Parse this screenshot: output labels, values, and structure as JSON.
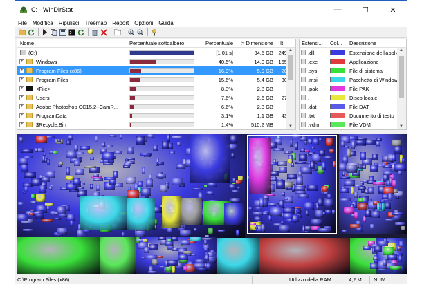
{
  "window": {
    "title": "C: - WinDirStat",
    "controls": {
      "minimize": "—",
      "maximize": "☐",
      "close": "✕"
    }
  },
  "menu": [
    "File",
    "Modifica",
    "Ripulisci",
    "Treemap",
    "Report",
    "Opzioni",
    "Guida"
  ],
  "toolbar_icons": [
    "open-icon",
    "refresh-icon",
    "play-icon",
    "copy-icon",
    "explorer-icon",
    "cmd-icon",
    "refresh-all-icon",
    "recycle-icon",
    "delete-icon",
    "folder-icon",
    "zoom-in-icon",
    "zoom-out-icon",
    "help-icon"
  ],
  "tree": {
    "columns": {
      "name": "Nome",
      "subtree_percent": "Percentuale sottoalbero",
      "percent": "Percentuale",
      "size": "> Dimensione",
      "items": "It"
    },
    "rows": [
      {
        "name": "(C:)",
        "subtree": 1.0,
        "percent": "[1:01 s]",
        "size": "34,5 GB",
        "items": "249",
        "expand": "",
        "icon": "drive",
        "selected": false
      },
      {
        "name": "Windows",
        "subtree": 0.405,
        "percent": "40,5%",
        "size": "14,0 GB",
        "items": "165",
        "expand": "+",
        "icon": "folder",
        "selected": false
      },
      {
        "name": "Program Files (x86)",
        "subtree": 0.169,
        "percent": "16,9%",
        "size": "5,9 GB",
        "items": "20",
        "expand": "+",
        "icon": "folder",
        "selected": true
      },
      {
        "name": "Program Files",
        "subtree": 0.156,
        "percent": "15,6%",
        "size": "5,4 GB",
        "items": "30",
        "expand": "+",
        "icon": "folder",
        "selected": false
      },
      {
        "name": "<File>",
        "subtree": 0.083,
        "percent": "8,3%",
        "size": "2,8 GB",
        "items": "",
        "expand": "+",
        "icon": "file",
        "selected": false
      },
      {
        "name": "Users",
        "subtree": 0.076,
        "percent": "7,6%",
        "size": "2,6 GB",
        "items": "27",
        "expand": "+",
        "icon": "folder",
        "selected": false
      },
      {
        "name": "Adobe Photoshop CC15.2+CamR...",
        "subtree": 0.066,
        "percent": "6,6%",
        "size": "2,3 GB",
        "items": "",
        "expand": "+",
        "icon": "folder",
        "selected": false
      },
      {
        "name": "ProgramData",
        "subtree": 0.031,
        "percent": "3,1%",
        "size": "1,1 GB",
        "items": "43",
        "expand": "+",
        "icon": "folder",
        "selected": false
      },
      {
        "name": "$Recycle.Bin",
        "subtree": 0.014,
        "percent": "1,4%",
        "size": "510,2 MB",
        "items": "",
        "expand": "+",
        "icon": "folder",
        "selected": false
      }
    ]
  },
  "extensions": {
    "columns": {
      "ext": "Estensi...",
      "color": "Col...",
      "desc": "Descrizione"
    },
    "rows": [
      {
        "ext": ".dll",
        "color": "#3a3ae0",
        "desc": "Estensione dell'applic"
      },
      {
        "ext": ".exe",
        "color": "#e03a3a",
        "desc": "Applicazione"
      },
      {
        "ext": ".sys",
        "color": "#3ae03a",
        "desc": "File di sistema"
      },
      {
        "ext": ".msi",
        "color": "#3ad8e8",
        "desc": "Pacchetto di Window"
      },
      {
        "ext": ".pak",
        "color": "#e03ae0",
        "desc": "File PAK"
      },
      {
        "ext": ".",
        "color": "#e8e83a",
        "desc": "Disco locale"
      },
      {
        "ext": ".dat",
        "color": "#5a5ae8",
        "desc": "File DAT"
      },
      {
        "ext": ".txt",
        "color": "#e85a5a",
        "desc": "Documento di testo"
      },
      {
        "ext": ".vdm",
        "color": "#5ae85a",
        "desc": "File VDM"
      }
    ]
  },
  "status": {
    "path": "C:\\Program Files (x86)",
    "ram_label": "Utilizzo della RAM:",
    "ram_value": "4,2 M",
    "num": "NUM"
  }
}
